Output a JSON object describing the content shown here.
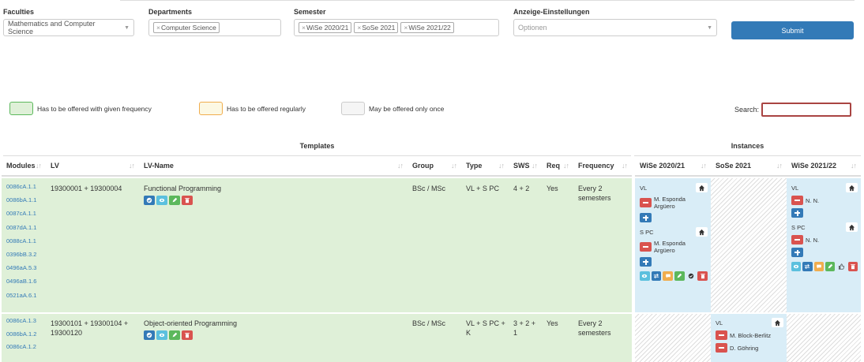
{
  "filters": {
    "faculties": {
      "label": "Faculties",
      "value": "Mathematics and Computer Science"
    },
    "departments": {
      "label": "Departments",
      "tags": [
        "Computer Science"
      ]
    },
    "semester": {
      "label": "Semester",
      "tags": [
        "WiSe 2020/21",
        "SoSe 2021",
        "WiSe 2021/22"
      ]
    },
    "display": {
      "label": "Anzeige-Einstellungen",
      "placeholder": "Optionen"
    },
    "submit_label": "Submit"
  },
  "legend": [
    {
      "label": "Has to be offered with given frequency",
      "fill": "#dff0d8",
      "border": "#5cb85c"
    },
    {
      "label": "Has to be offered regularly",
      "fill": "#fcf8e3",
      "border": "#f0ad4e"
    },
    {
      "label": "May be offered only once",
      "fill": "#f5f5f5",
      "border": "#ccc"
    }
  ],
  "search": {
    "label": "Search:"
  },
  "table": {
    "group_templates": "Templates",
    "group_instances": "Instances",
    "columns": {
      "modules": "Modules",
      "lv": "LV",
      "lv_name": "LV-Name",
      "group": "Group",
      "type": "Type",
      "sws": "SWS",
      "req": "Req",
      "frequency": "Frequency",
      "wise2020": "WiSe 2020/21",
      "sose2021": "SoSe 2021",
      "wise2021": "WiSe 2021/22"
    },
    "rows": [
      {
        "modules": [
          "0086cA.1.1",
          "0086bA.1.1",
          "0087cA.1.1",
          "0087dA.1.1",
          "0088cA.1.1",
          "0396bB.3.2",
          "0496aA.5.3",
          "0496aB.1.6",
          "0521aA.6.1"
        ],
        "lv": "19300001 + 19300004",
        "lv_name": "Functional Programming",
        "group": "BSc / MSc",
        "type": "VL + S PC",
        "sws": "4 + 2",
        "req": "Yes",
        "frequency": "Every 2 semesters",
        "wise2020": [
          {
            "kind": "VL",
            "people": [
              "M. Esponda Argüero"
            ]
          },
          {
            "kind": "S PC",
            "people": [
              "M. Esponda Argüero"
            ]
          }
        ],
        "wise2021": [
          {
            "kind": "VL",
            "people": [
              "N. N."
            ]
          },
          {
            "kind": "S PC",
            "people": [
              "N. N."
            ]
          }
        ]
      },
      {
        "modules": [
          "0086cA.1.3",
          "0086bA.1.2",
          "0086cA.1.2"
        ],
        "lv_lines": [
          "19300101 + 19300104 +",
          "19300120"
        ],
        "lv_name": "Object-oriented Programming",
        "group": "BSc / MSc",
        "type_lines": [
          "VL + S PC +",
          "K"
        ],
        "sws_lines": [
          "3 + 2 +",
          "1"
        ],
        "req": "Yes",
        "frequency": "Every 2 semesters",
        "sose2021": [
          {
            "kind": "VL",
            "people": [
              "M. Block-Berlitz",
              "D. Göhring"
            ]
          }
        ]
      }
    ]
  }
}
